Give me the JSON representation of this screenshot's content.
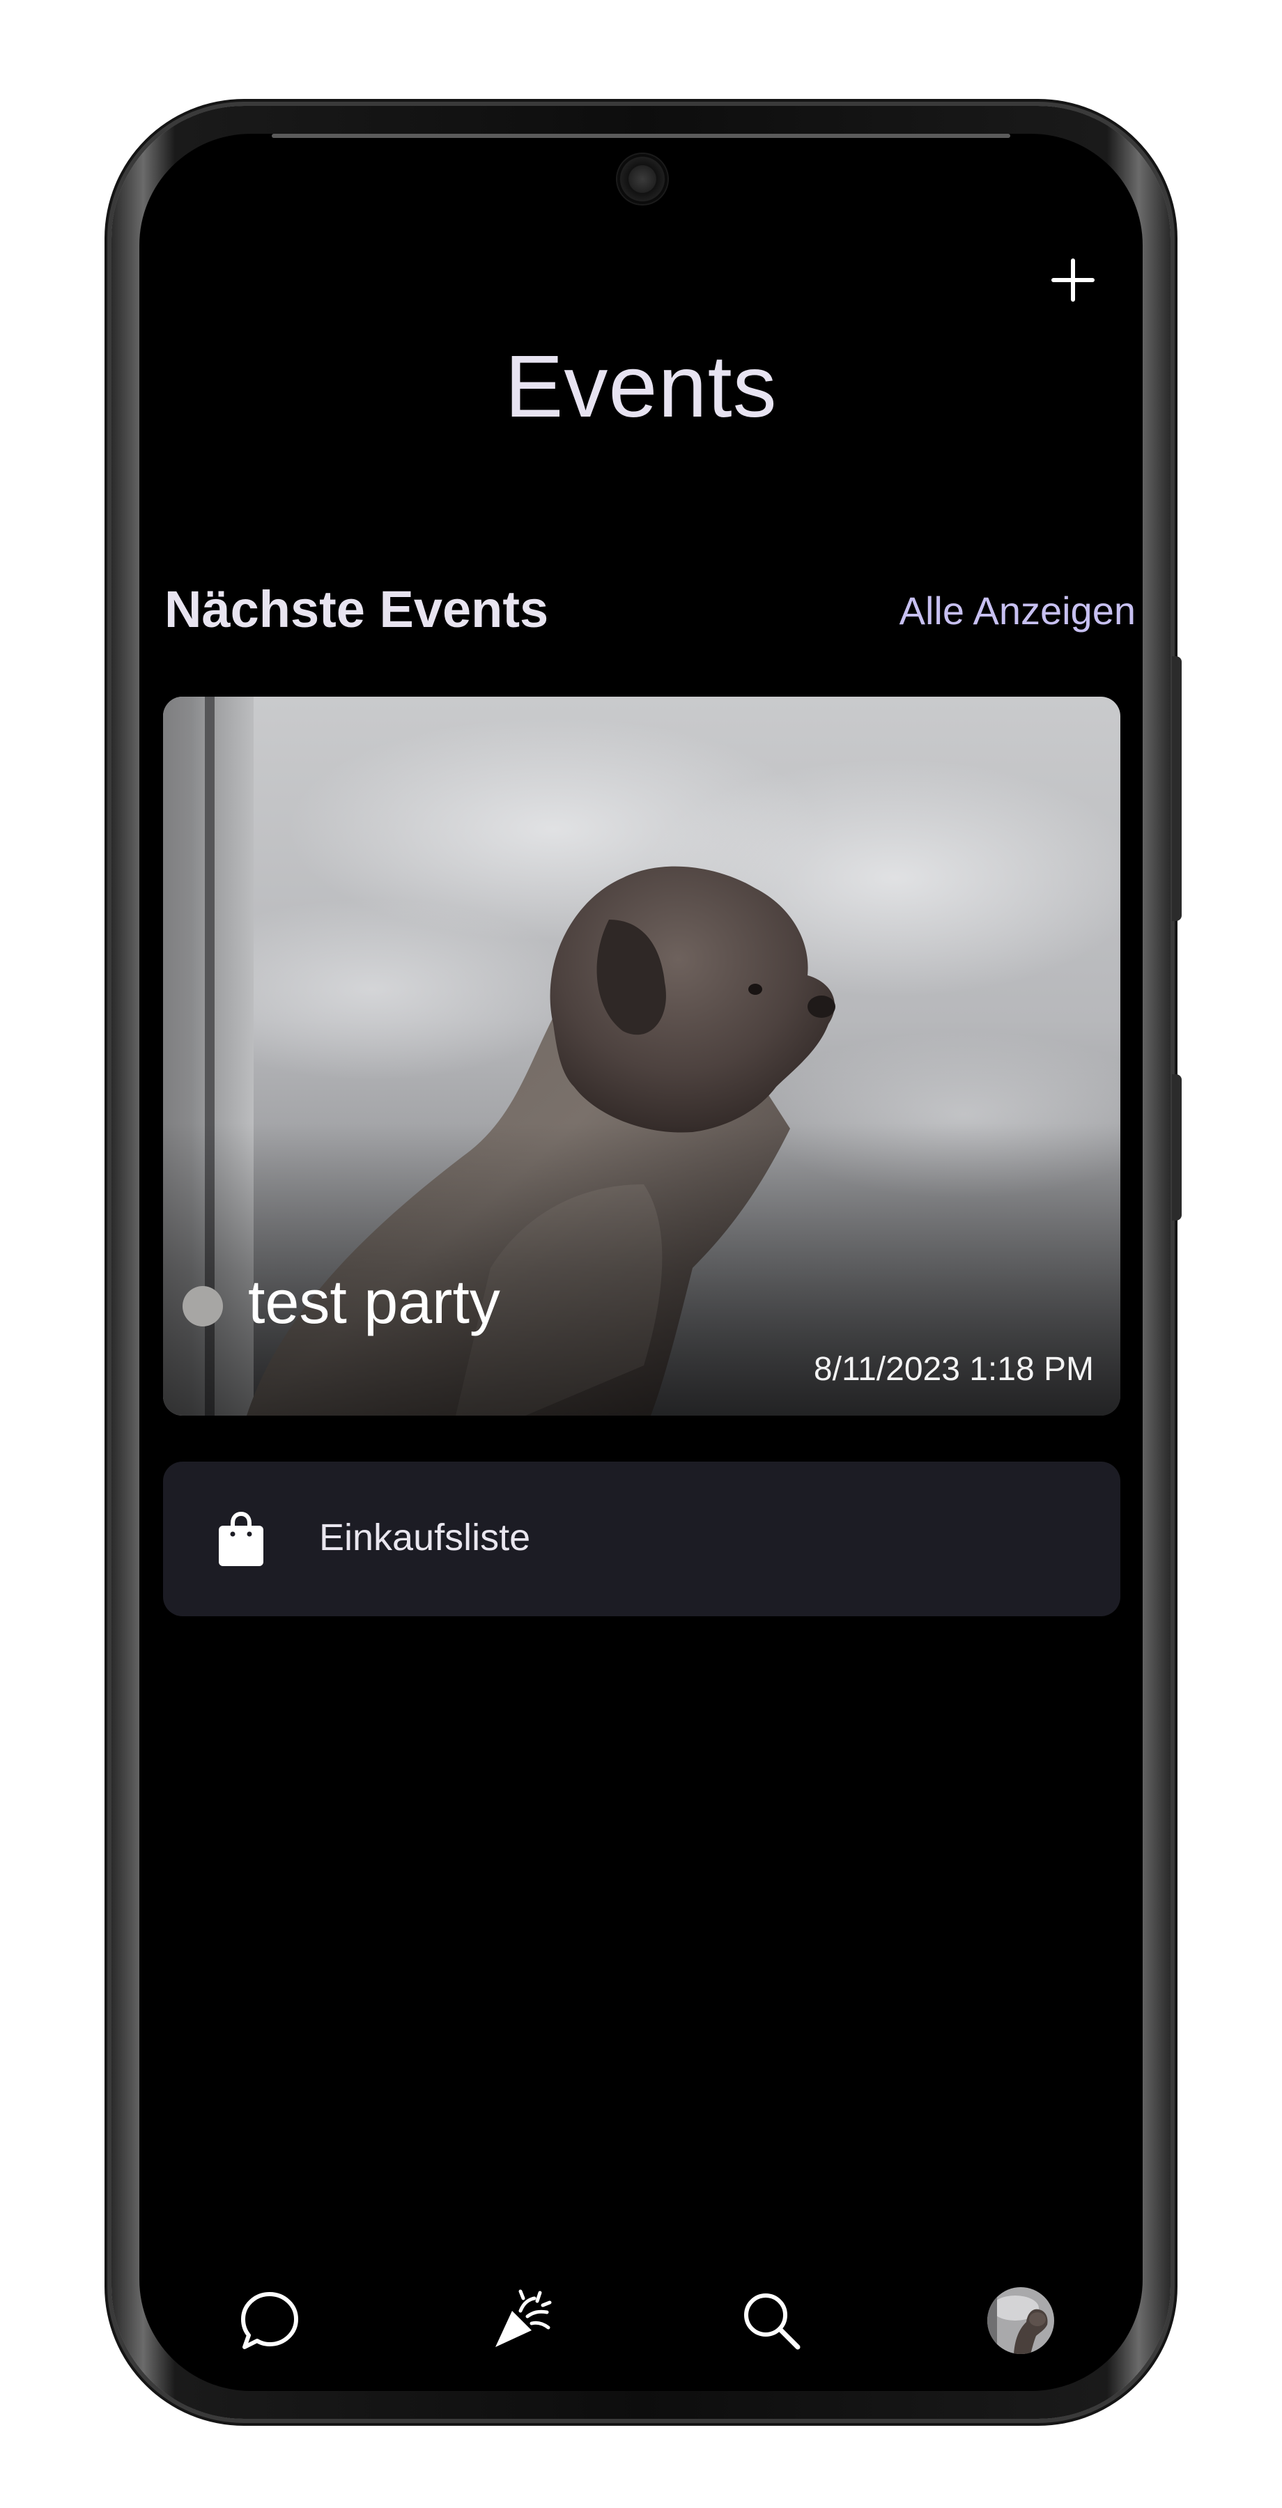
{
  "header": {
    "title": "Events",
    "add_icon": "plus-icon"
  },
  "upcoming": {
    "section_title": "Nächste Events",
    "see_all_label": "Alle Anzeigen"
  },
  "event": {
    "title": "test party",
    "datetime": "8/11/2023 1:18 PM",
    "image": "dog-looking-out-window-photo"
  },
  "shopping_list": {
    "label": "Einkaufsliste",
    "icon": "shopping-bag-icon"
  },
  "bottom_nav": {
    "items": [
      {
        "icon": "chat-bubble-icon"
      },
      {
        "icon": "party-popper-icon"
      },
      {
        "icon": "search-icon"
      },
      {
        "icon": "profile-avatar"
      }
    ]
  },
  "colors": {
    "background": "#000000",
    "accent": "#c7c0f1",
    "title_text": "#e7e3f1",
    "card": "#1c1c24",
    "status_dot": "#a7a6a4"
  }
}
